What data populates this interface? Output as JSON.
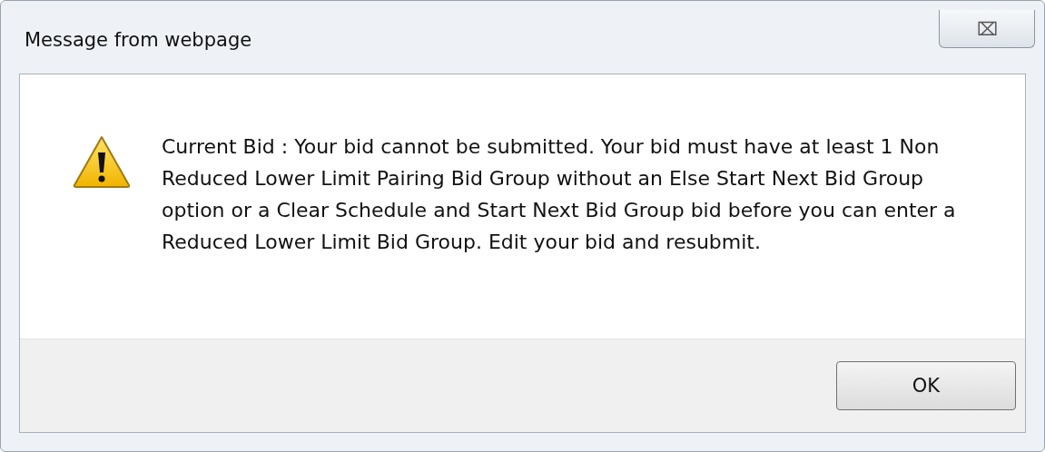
{
  "window": {
    "title": "Message from webpage",
    "close": "⌧"
  },
  "message": "Current Bid : Your bid cannot be submitted. Your bid must have at least 1 Non Reduced Lower Limit Pairing Bid Group without an Else Start Next Bid Group option or a Clear Schedule and Start Next Bid Group bid before you can enter a Reduced Lower Limit Bid Group. Edit your bid and resubmit.",
  "buttons": [
    "OK"
  ]
}
